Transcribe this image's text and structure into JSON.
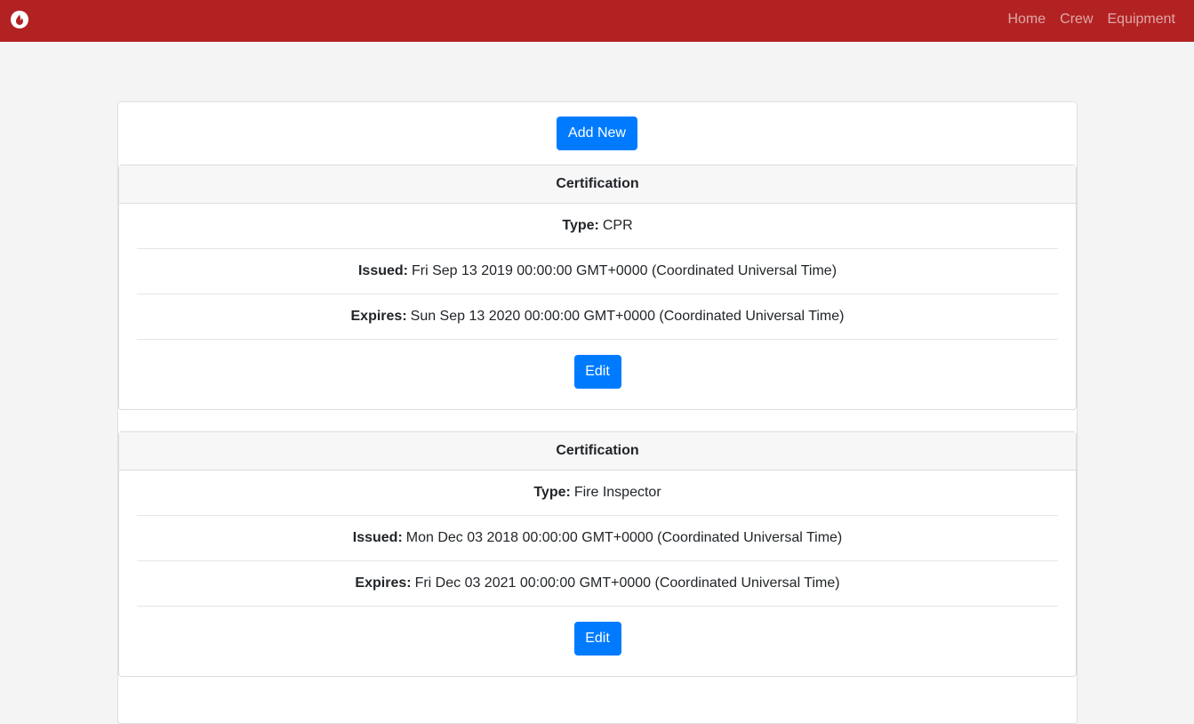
{
  "nav": {
    "brand_icon": "fire-icon",
    "links": [
      "Home",
      "Crew",
      "Equipment"
    ]
  },
  "colors": {
    "navbar": "#b22222",
    "primary_button": "#007bff"
  },
  "toolbar": {
    "add_label": "Add New"
  },
  "certifications": [
    {
      "header": "Certification",
      "type_label": "Type:",
      "type": "CPR",
      "issued_label": "Issued:",
      "issued": "Fri Sep 13 2019 00:00:00 GMT+0000 (Coordinated Universal Time)",
      "expires_label": "Expires:",
      "expires": "Sun Sep 13 2020 00:00:00 GMT+0000 (Coordinated Universal Time)",
      "edit_label": "Edit"
    },
    {
      "header": "Certification",
      "type_label": "Type:",
      "type": "Fire Inspector",
      "issued_label": "Issued:",
      "issued": "Mon Dec 03 2018 00:00:00 GMT+0000 (Coordinated Universal Time)",
      "expires_label": "Expires:",
      "expires": "Fri Dec 03 2021 00:00:00 GMT+0000 (Coordinated Universal Time)",
      "edit_label": "Edit"
    }
  ]
}
